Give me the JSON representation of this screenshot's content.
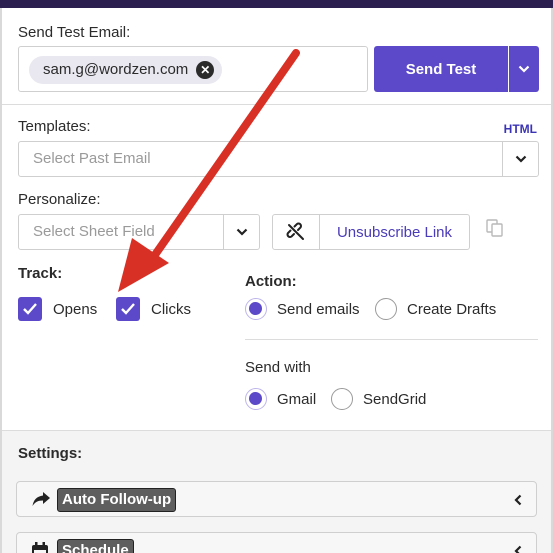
{
  "send_test": {
    "label": "Send Test Email:",
    "chip_email": "sam.g@wordzen.com",
    "button_label": "Send Test"
  },
  "templates": {
    "label": "Templates:",
    "html_link": "HTML",
    "placeholder": "Select Past Email"
  },
  "personalize": {
    "label": "Personalize:",
    "placeholder": "Select Sheet Field",
    "unsubscribe_label": "Unsubscribe Link"
  },
  "track": {
    "label": "Track:",
    "opens_label": "Opens",
    "opens_checked": true,
    "clicks_label": "Clicks",
    "clicks_checked": true
  },
  "action": {
    "label": "Action:",
    "options": [
      "Send emails",
      "Create Drafts"
    ],
    "selected": "Send emails"
  },
  "send_with": {
    "label": "Send with",
    "options": [
      "Gmail",
      "SendGrid"
    ],
    "selected": "Gmail"
  },
  "settings": {
    "label": "Settings:",
    "items": [
      {
        "label": "Auto Follow-up",
        "icon": "share-arrow-icon"
      },
      {
        "label": "Schedule",
        "icon": "calendar-icon"
      }
    ]
  },
  "colors": {
    "accent": "#5b49c9",
    "annotation_arrow": "#d93025",
    "header": "#2a1f4e"
  }
}
